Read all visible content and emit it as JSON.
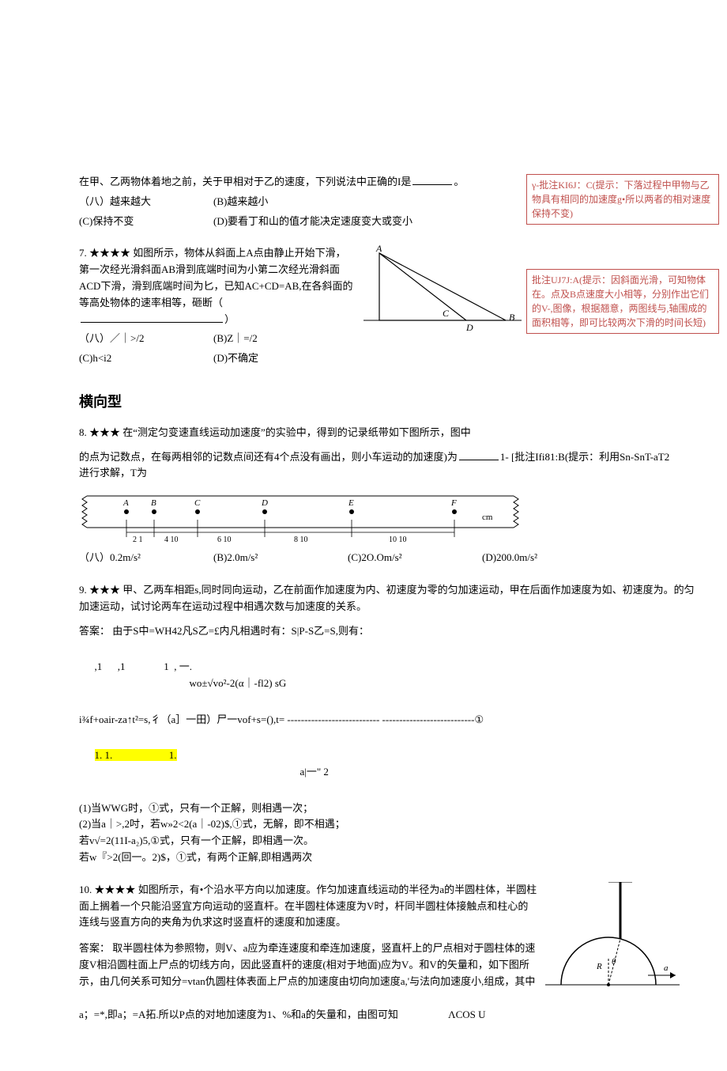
{
  "q6": {
    "stem": "在甲、乙两物体着地之前，关于甲相对于乙的速度，下列说法中正确的I是",
    "tail": "。",
    "optA": "（八）越来越大",
    "optB": "(B)越来越小",
    "optC": "(C)保持不变",
    "optD": "(D)要看丁和山的值才能决定速度变大或变小"
  },
  "anno6": {
    "label": "γ-批注KI6J：C",
    "text": "(提示：下落过程中甲物与乙物具有相同的加速度g•所以两者的相对速度保持不变)"
  },
  "q7": {
    "num": "7.",
    "stars": "★★★★",
    "stem1": "如图所示，物体从斜面上A点由静止开始下滑，第一次经光滑斜面AB滑到底端时间为小第二次经光滑斜面ACD下滑，滑到底端时间为匕，已知AC+CD=AB,在各斜面的等高处物体的速率相等，砸断（",
    "stem2": "）",
    "optA": "（八）／｜>/2",
    "optB": "(B)Z｜=/2",
    "optC": "(C)h<i2",
    "optD": "(D)不确定"
  },
  "anno7": {
    "label": "批注UJ7J:A",
    "text": "(提示：因斜面光滑，可知物体在。点及B点速度大小相等，分别作出它们的V-,图像，根据翘意，两图线与,轴围成的面积相等，即可比较两次下滑的时间长短)"
  },
  "sectionHead": "横向型",
  "q8": {
    "num": "8.",
    "stars": "★★★",
    "stem1": "在“测定匀变速直线运动加速度”的实验中，得到的记录纸带如下图所示，图中",
    "stem2": "的点为记数点，在每两相邻的记数点间还有4个点没有画出，则小车运动的加速度)为",
    "tail": "1-",
    "optA": "（八）0.2m/s²",
    "optB": "(B)2.0m/s²",
    "optC": "(C)2O.Om/s²",
    "optD": "(D)200.0m/s²"
  },
  "anno8": {
    "label": "[批注Ifi81:B",
    "text": "(提示：利用Sn-SnT-aT2进行求解，T为"
  },
  "ruler": {
    "labels": [
      "A",
      "B",
      "C",
      "D",
      "E",
      "F"
    ],
    "unit": "cm",
    "segs": [
      "2 1",
      "4 10",
      "6 10",
      "8 10",
      "10 10"
    ]
  },
  "q9": {
    "num": "9.",
    "stars": "★★★",
    "stem": "甲、乙两车相距s,同时同向运动，乙在前面作加速度为内、初速度为零的匀加速运动，甲在后面作加速度为如、初速度为。的匀加速运动，试讨论两车在运动过程中相遇次数与加速度的关系。",
    "ansLabel": "答案：",
    "ans1": "由于S中=WH42凡S乙=£内凡相遇时有：S|P-S乙=S,则有：",
    "row1a": ",1      ,1               1  , 一.",
    "row1b": "wo±√vo²-2(α｜-fl2) sG",
    "row2a": "i¾f+oair-za↑t²=s,彳（a］一田）尸一vof+s=(),t=",
    "row2b": "--------------------------- ---------------------------①",
    "row3a": "1. 1.                      1.",
    "row3b": "a|一\" 2",
    "l1": "(1)当WWG时，①式，只有一个正解，则相遇一次；",
    "l2": "(2)当a｜>,2吋，若w»2<2(a｜-02)$,①式，无解，即不相遇；",
    "l3": "若v√=2(11I-a₂)5,①式，只有一个正解，即相遇一次。",
    "l4": "若w『>2(回一。2)$，①式，有两个正解,即相遇两次"
  },
  "q10": {
    "num": "10.",
    "stars": "★★★★",
    "stem": "如图所示，有•个沿水平方向以加速度。作匀加速直线运动的半径为a的半圆柱体，半圆柱面上搁着一个只能沿竖宜方向运动的竖直杆。在半圆柱体速度为V时，杆同半圆柱体接触点和柱心的连线与竖直方向的夹角为仇求这时竖直杆的速度和加速度。",
    "ansLabel": "答案：",
    "ans1": "取半圆柱体为参照物，则V、a应为牵连速度和牵连加速度，竖直杆上的尸点相对于圆柱体的速度V相沿圆柱面上尸点的切线方向，因此竖直杆的速度(相对于地面)应为V。和V的矢量和，如下图所示，由几何关系可知分=vtan仇圆柱体表面上尸点的加速度由切向加速度a,'与法向加速度小,组成，其中",
    "ans2": "a；=*,即a；=A拓.所以P点的对地加速度为1、%和a的矢量和，由图可知",
    "ans3": "ΛCOS U"
  }
}
